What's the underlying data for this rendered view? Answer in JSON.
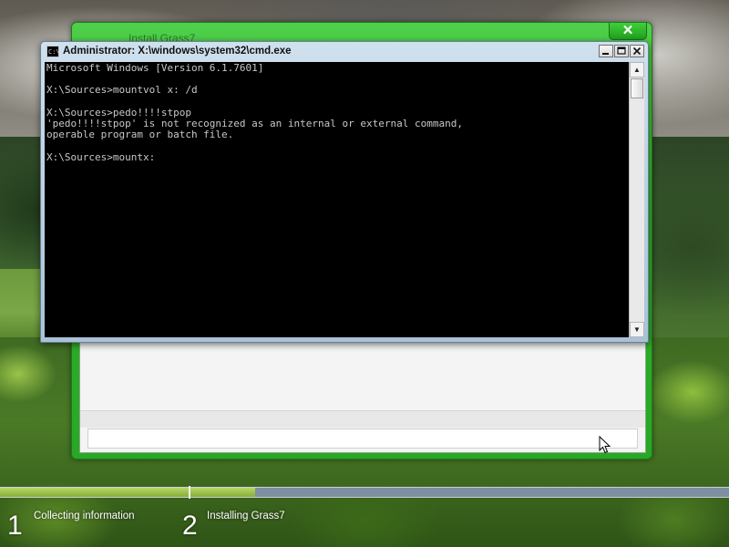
{
  "setup_window": {
    "title": "Install Grass7",
    "close_glyph": "✕"
  },
  "cmd": {
    "title": "Administrator: X:\\windows\\system32\\cmd.exe",
    "icon_text": "C:\\",
    "lines": [
      "Microsoft Windows [Version 6.1.7601]",
      "",
      "X:\\Sources>mountvol x: /d",
      "",
      "X:\\Sources>pedo!!!!stpop",
      "'pedo!!!!stpop' is not recognized as an internal or external command,",
      "operable program or batch file.",
      "",
      "X:\\Sources>mountx:"
    ],
    "controls": [
      "minimize-icon",
      "maximize-icon",
      "close-icon"
    ],
    "scroll_up_glyph": "▲",
    "scroll_down_glyph": "▼"
  },
  "steps": [
    {
      "number": "1",
      "label": "Collecting information",
      "progress": 1.0
    },
    {
      "number": "2",
      "label": "Installing Grass7",
      "progress": 0.12
    }
  ],
  "colors": {
    "setup_frame": "#2fb02c",
    "progress_fill": "#86ae34",
    "progress_track": "#7d8fa0",
    "console_bg": "#000000",
    "console_text": "#c8c8c8"
  }
}
